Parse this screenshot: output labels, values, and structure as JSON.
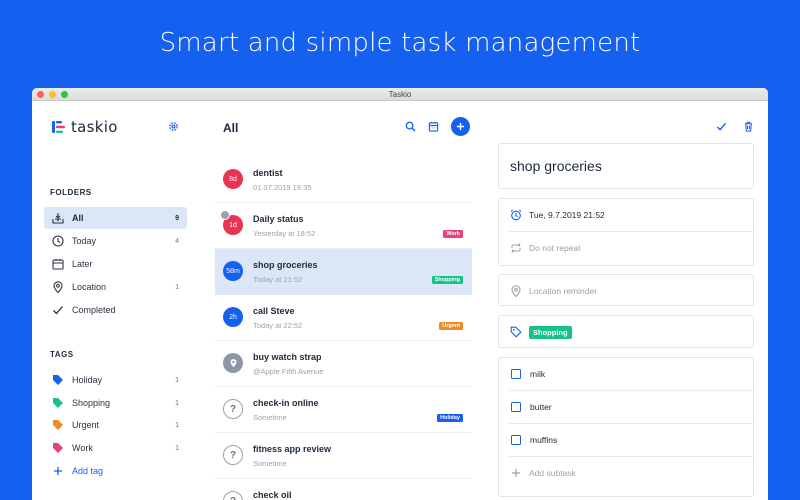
{
  "hero": "Smart and simple task management",
  "window_title": "Taskio",
  "app": {
    "logo": "taskio"
  },
  "sidebar": {
    "folders_heading": "FOLDERS",
    "folders": [
      {
        "label": "All",
        "count": "9",
        "icon": "inbox-icon"
      },
      {
        "label": "Today",
        "count": "4",
        "icon": "clock-icon"
      },
      {
        "label": "Later",
        "count": "",
        "icon": "calendar-icon"
      },
      {
        "label": "Location",
        "count": "1",
        "icon": "location-pin-icon"
      },
      {
        "label": "Completed",
        "count": "",
        "icon": "checkmark-icon"
      }
    ],
    "tags_heading": "TAGS",
    "tags": [
      {
        "label": "Holiday",
        "count": "1",
        "color": "#1560ef"
      },
      {
        "label": "Shopping",
        "count": "1",
        "color": "#16c28a"
      },
      {
        "label": "Urgent",
        "count": "1",
        "color": "#f08a24"
      },
      {
        "label": "Work",
        "count": "1",
        "color": "#e8407a"
      }
    ],
    "add_tag": "Add tag"
  },
  "list": {
    "title": "All",
    "tasks": [
      {
        "badge": "8d",
        "title": "dentist",
        "sub": "01.07.2019 19:35",
        "tag": ""
      },
      {
        "badge": "1d",
        "title": "Daily status",
        "sub": "Yesterday at 18:52",
        "tag": "Work"
      },
      {
        "badge": "58m",
        "title": "shop groceries",
        "sub": "Today at 21:52",
        "tag": "Shopping"
      },
      {
        "badge": "2h",
        "title": "call Steve",
        "sub": "Today at 22:52",
        "tag": "Urgent"
      },
      {
        "badge": "",
        "title": "buy watch strap",
        "sub": "@Apple Fifth Avenue",
        "tag": ""
      },
      {
        "badge": "?",
        "title": "check-in online",
        "sub": "Sometime",
        "tag": "Holiday"
      },
      {
        "badge": "?",
        "title": "fitness app review",
        "sub": "Sometime",
        "tag": ""
      },
      {
        "badge": "?",
        "title": "check oil",
        "sub": "",
        "tag": ""
      }
    ]
  },
  "detail": {
    "title": "shop groceries",
    "due": "Tue, 9.7.2019 21:52",
    "repeat": "Do not repeat",
    "location": "Location reminder",
    "tag": "Shopping",
    "subtasks": [
      "milk",
      "butter",
      "muffins"
    ],
    "add_subtask": "Add subtask"
  }
}
